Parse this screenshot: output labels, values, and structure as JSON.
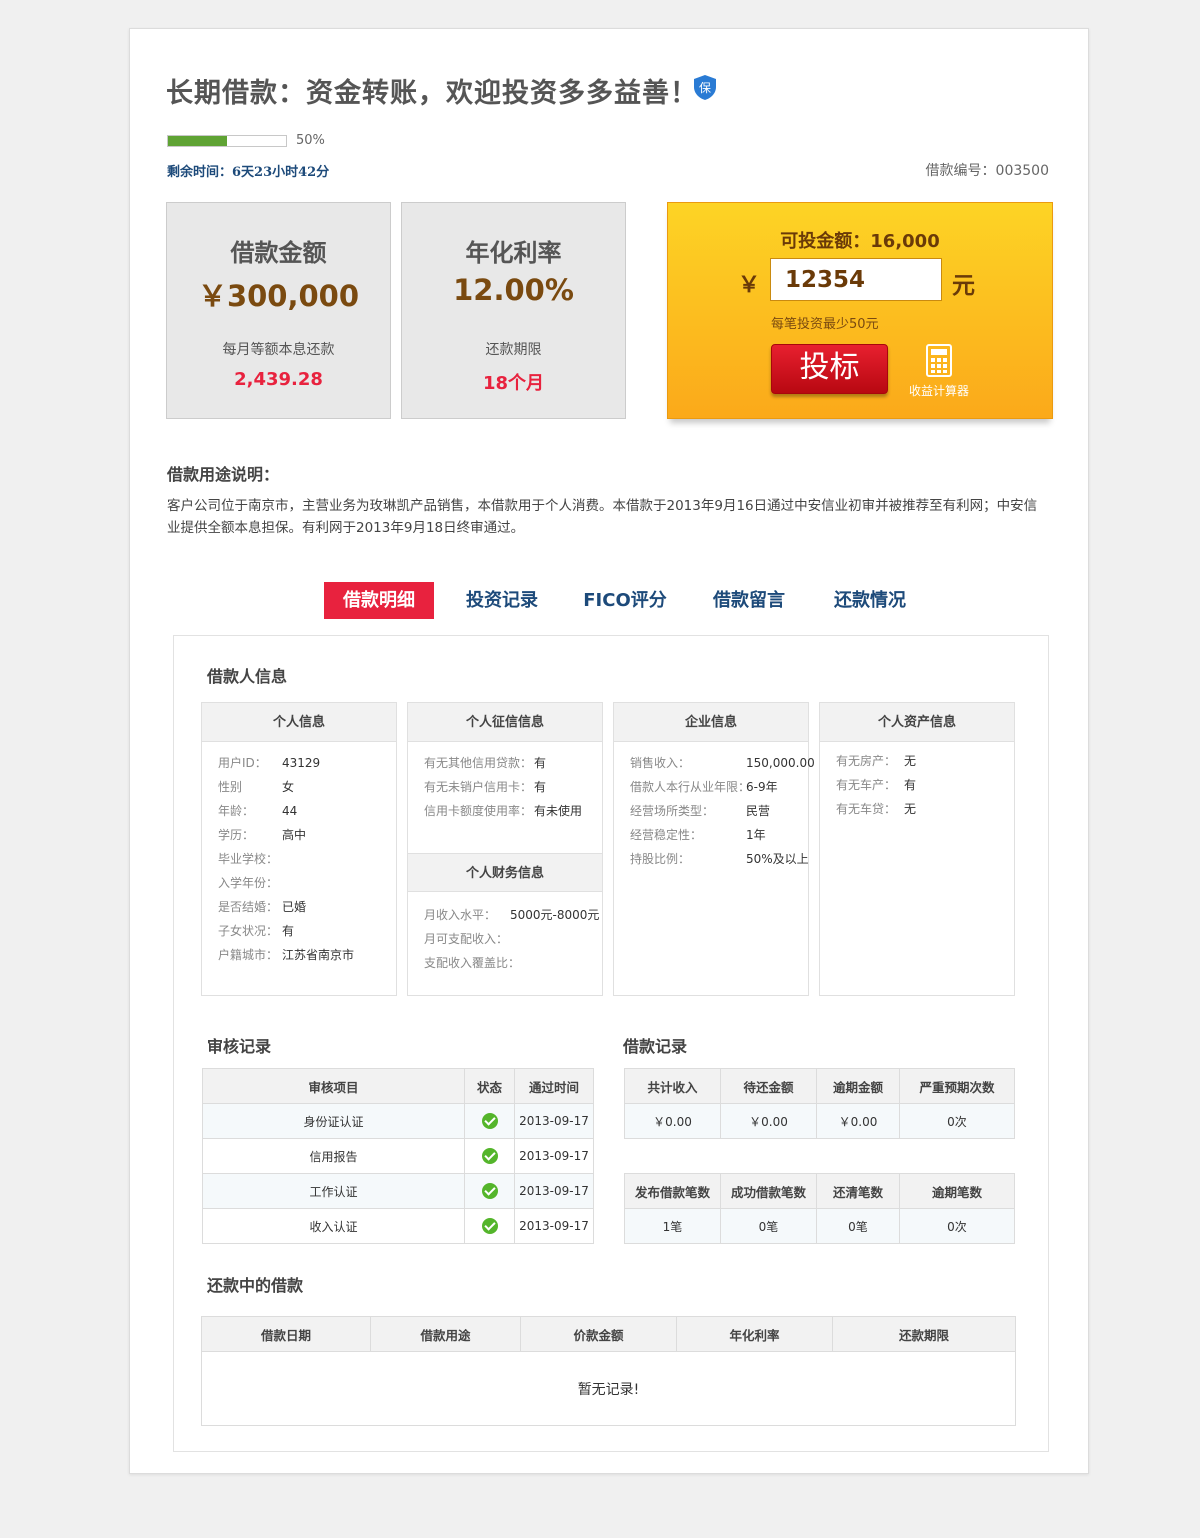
{
  "header": {
    "title": "长期借款：资金转账，欢迎投资多多益善！",
    "badge": "保",
    "progress_percent": 50,
    "progress_label": "50%",
    "remaining_time": "剩余时间：6天23小时42分",
    "loan_no": "借款编号：003500"
  },
  "amount_box": {
    "heading": "借款金额",
    "value": "￥300,000",
    "sub_label": "每月等额本息还款",
    "sub_value": "2,439.28"
  },
  "rate_box": {
    "heading": "年化利率",
    "value": "12.00%",
    "sub_label": "还款期限",
    "sub_value": "18个月"
  },
  "invest": {
    "available": "可投金额：16,000",
    "currency": "￥",
    "amount_value": "12354",
    "unit": "元",
    "min_note": "每笔投资最少50元",
    "button_label": "投标",
    "calculator_label": "收益计算器"
  },
  "purpose": {
    "heading": "借款用途说明：",
    "text": "客户公司位于南京市，主营业务为玫琳凯产品销售，本借款用于个人消费。本借款于2013年9月16日通过中安信业初审并被推荐至有利网；中安信业提供全额本息担保。有利网于2013年9月18日终审通过。"
  },
  "tabs": [
    "借款明细",
    "投资记录",
    "FICO评分",
    "借款留言",
    "还款情况"
  ],
  "borrower": {
    "heading": "借款人信息",
    "personal": {
      "title": "个人信息",
      "rows": [
        {
          "k": "用户ID：",
          "v": "43129"
        },
        {
          "k": "性别",
          "v": "女"
        },
        {
          "k": "年龄：",
          "v": "44"
        },
        {
          "k": "学历：",
          "v": "高中"
        },
        {
          "k": "毕业学校：",
          "v": ""
        },
        {
          "k": "入学年份：",
          "v": ""
        },
        {
          "k": "是否结婚：",
          "v": "已婚"
        },
        {
          "k": "子女状况：",
          "v": "有"
        },
        {
          "k": "户籍城市：",
          "v": "江苏省南京市"
        }
      ]
    },
    "credit": {
      "title": "个人征信信息",
      "rows": [
        {
          "k": "有无其他信用贷款：",
          "v": "有"
        },
        {
          "k": "有无未销户信用卡：",
          "v": "有"
        },
        {
          "k": "信用卡额度使用率：",
          "v": "有未使用"
        }
      ]
    },
    "finance": {
      "title": "个人财务信息",
      "rows": [
        {
          "k": "月收入水平：",
          "v": "5000元-8000元"
        },
        {
          "k": "月可支配收入：",
          "v": ""
        },
        {
          "k": "支配收入覆盖比：",
          "v": ""
        }
      ]
    },
    "company": {
      "title": "企业信息",
      "rows": [
        {
          "k": "销售收入：",
          "v": "150,000.00"
        },
        {
          "k": "借款人本行从业年限：",
          "v": "6-9年"
        },
        {
          "k": "经营场所类型：",
          "v": "民营"
        },
        {
          "k": "经营稳定性：",
          "v": "1年"
        },
        {
          "k": "持股比例：",
          "v": "50%及以上"
        }
      ]
    },
    "assets": {
      "title": "个人资产信息",
      "rows": [
        {
          "k": "有无房产：",
          "v": "无"
        },
        {
          "k": "有无车产：",
          "v": "有"
        },
        {
          "k": "有无车贷：",
          "v": "无"
        }
      ]
    }
  },
  "audit": {
    "heading": "审核记录",
    "columns": [
      "审核项目",
      "状态",
      "通过时间"
    ],
    "rows": [
      {
        "item": "身份证认证",
        "date": "2013-09-17"
      },
      {
        "item": "信用报告",
        "date": "2013-09-17"
      },
      {
        "item": "工作认证",
        "date": "2013-09-17"
      },
      {
        "item": "收入认证",
        "date": "2013-09-17"
      }
    ]
  },
  "loan_record": {
    "heading": "借款记录",
    "table1": {
      "columns": [
        "共计收入",
        "待还金额",
        "逾期金额",
        "严重预期次数"
      ],
      "values": [
        "￥0.00",
        "￥0.00",
        "￥0.00",
        "0次"
      ]
    },
    "table2": {
      "columns": [
        "发布借款笔数",
        "成功借款笔数",
        "还清笔数",
        "逾期笔数"
      ],
      "values": [
        "1笔",
        "0笔",
        "0笔",
        "0次"
      ]
    }
  },
  "repaying": {
    "heading": "还款中的借款",
    "columns": [
      "借款日期",
      "借款用途",
      "价款金额",
      "年化利率",
      "还款期限"
    ],
    "empty": "暂无记录!"
  },
  "colors": {
    "accent_red": "#e8223e",
    "navy": "#1d4a7a",
    "progress_green": "#5fa334",
    "invest_orange": "#fba91a"
  }
}
